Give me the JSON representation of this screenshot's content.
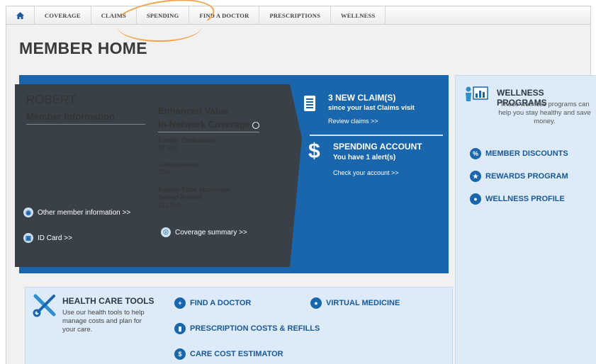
{
  "nav": {
    "home_icon": "home-icon",
    "items": [
      "COVERAGE",
      "CLAIMS",
      "SPENDING",
      "FIND A DOCTOR",
      "PRESCRIPTIONS",
      "WELLNESS"
    ]
  },
  "page_title": "MEMBER HOME",
  "member": {
    "name": "ROBERT",
    "info_heading": "Member Information",
    "other_info_link": "Other member information >>",
    "id_card_link": "ID Card >>"
  },
  "coverage": {
    "title_line1": "Enhanced Value",
    "title_line2": "In-Network Coverage",
    "family_deductible_label": "Family Deductible",
    "family_deductible_value": "$2,600",
    "coinsurance_label": "Coinsurance",
    "coinsurance_value": "10%",
    "max_oop_label_line1": "Family Total Maximum",
    "max_oop_label_line2": "Out-of-Pocket",
    "max_oop_value": "$11,550",
    "summary_link": "Coverage summary >>"
  },
  "claims": {
    "heading": "3 NEW CLAIM(S)",
    "sub": "since your last Claims visit",
    "link": "Review claims >>"
  },
  "spending": {
    "icon": "$",
    "heading": "SPENDING ACCOUNT",
    "sub": "You have 1 alert(s)",
    "link": "Check your account >>"
  },
  "wellness": {
    "title": "WELLNESS PROGRAMS",
    "description": "These wellness programs can help you stay healthy and save money.",
    "links": [
      "MEMBER DISCOUNTS",
      "REWARDS PROGRAM",
      "WELLNESS PROFILE"
    ]
  },
  "tools": {
    "title": "HEALTH CARE TOOLS",
    "description": "Use our health tools to help manage costs and plan for your care.",
    "find_doctor": "FIND A DOCTOR",
    "prescription": "PRESCRIPTION COSTS & REFILLS",
    "care_cost": "CARE COST ESTIMATOR",
    "virtual": "VIRTUAL MEDICINE"
  },
  "colors": {
    "primary_blue": "#1a66ad",
    "dark_panel": "#394048",
    "light_panel": "#dcebf7",
    "highlight_circle": "#f0a54a"
  }
}
